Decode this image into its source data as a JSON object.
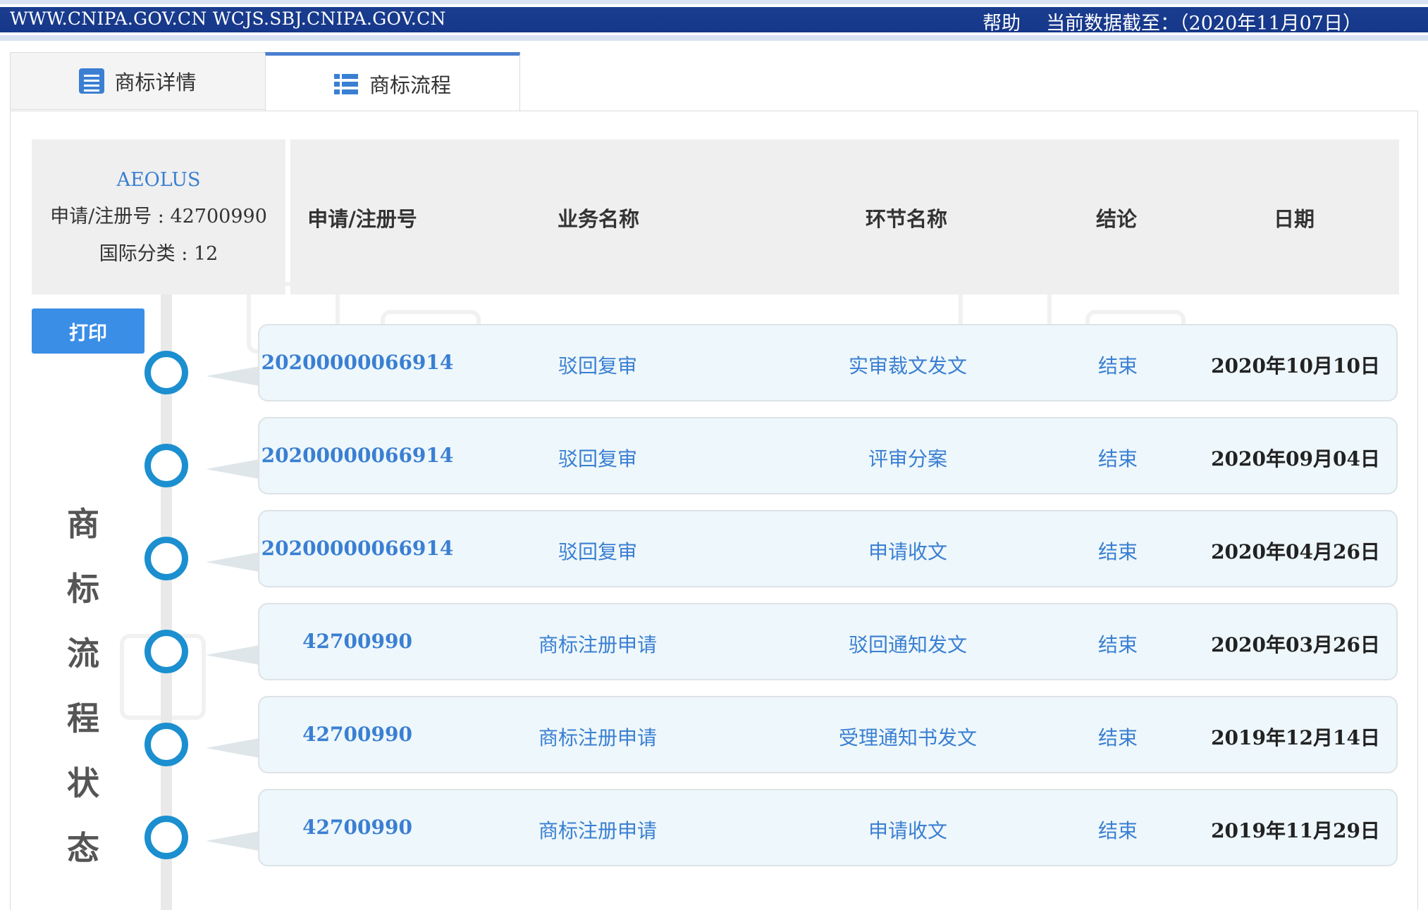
{
  "topbar": {
    "urls": "WWW.CNIPA.GOV.CN WCJS.SBJ.CNIPA.GOV.CN",
    "help": "帮助",
    "data_cutoff": "当前数据截至：（2020年11月07日）"
  },
  "tabs": [
    {
      "label": "商标详情",
      "icon": "document-list-icon",
      "active": false
    },
    {
      "label": "商标流程",
      "icon": "list-icon",
      "active": true
    }
  ],
  "info": {
    "mark_name": "AEOLUS",
    "reg_no": "申请/注册号 : 42700990",
    "intl_class": "国际分类 : 12"
  },
  "table_headers": [
    "申请/注册号",
    "业务名称",
    "环节名称",
    "结论",
    "日期"
  ],
  "print_label": "打印",
  "side_title": [
    "商",
    "标",
    "流",
    "程",
    "状",
    "态"
  ],
  "rows": [
    {
      "no": "20200000066914",
      "business": "驳回复审",
      "stage": "实审裁文发文",
      "result": "结束",
      "date": "2020年10月10日"
    },
    {
      "no": "20200000066914",
      "business": "驳回复审",
      "stage": "评审分案",
      "result": "结束",
      "date": "2020年09月04日"
    },
    {
      "no": "20200000066914",
      "business": "驳回复审",
      "stage": "申请收文",
      "result": "结束",
      "date": "2020年04月26日"
    },
    {
      "no": "42700990",
      "business": "商标注册申请",
      "stage": "驳回通知发文",
      "result": "结束",
      "date": "2020年03月26日"
    },
    {
      "no": "42700990",
      "business": "商标注册申请",
      "stage": "受理通知书发文",
      "result": "结束",
      "date": "2019年12月14日"
    },
    {
      "no": "42700990",
      "business": "商标注册申请",
      "stage": "申请收文",
      "result": "结束",
      "date": "2019年11月29日"
    }
  ],
  "colors": {
    "top_bar": "#16378a",
    "accent": "#3a7fd2",
    "circle": "#1b8fcf",
    "print_button": "#3a8ee6",
    "card_bg": "#eef7fb"
  }
}
